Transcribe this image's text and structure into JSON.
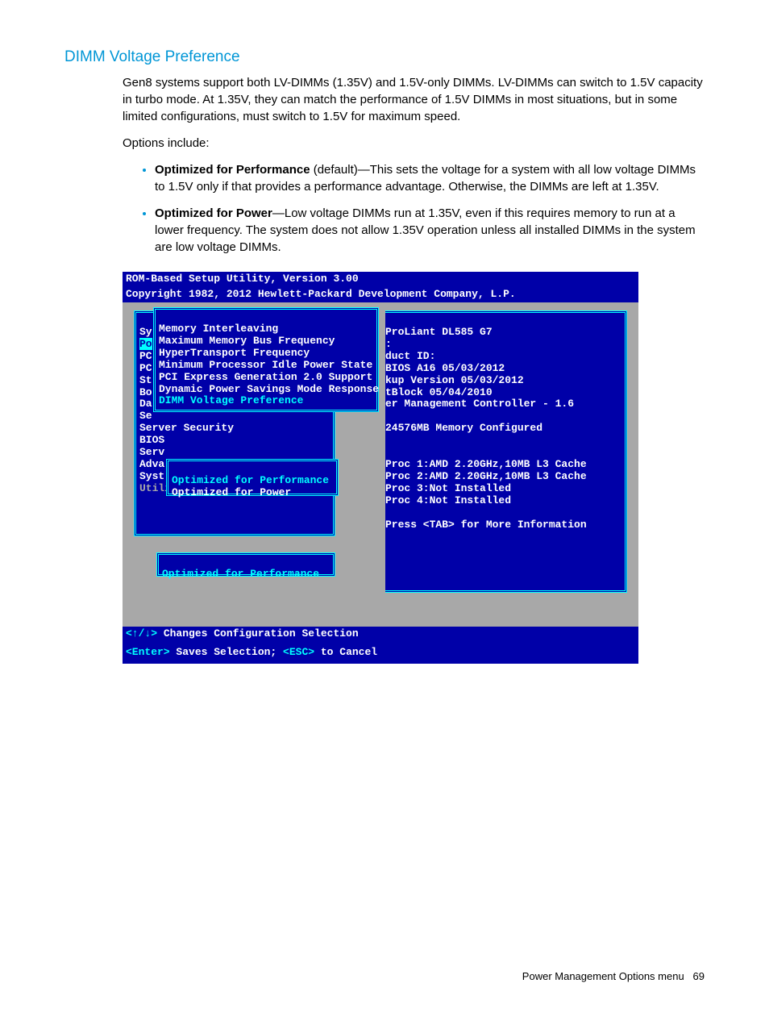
{
  "heading": "DIMM Voltage Preference",
  "para1": "Gen8 systems support both LV-DIMMs (1.35V) and 1.5V-only DIMMs. LV-DIMMs can switch to 1.5V capacity in turbo mode. At 1.35V, they can match the performance of 1.5V DIMMs in most situations, but in some limited configurations, must switch to 1.5V for maximum speed.",
  "options_label": "Options include:",
  "bullets": [
    {
      "strong": "Optimized for Performance",
      "rest": " (default)—This sets the voltage for a system with all low voltage DIMMs to 1.5V only if that provides a performance advantage. Otherwise, the DIMMs are left at 1.35V."
    },
    {
      "strong": "Optimized for Power",
      "rest": "—Low voltage DIMMs run at 1.35V, even if this requires memory to run at a lower frequency. The system does not allow 1.35V operation unless all installed DIMMs in the system are low voltage DIMMs."
    }
  ],
  "bios": {
    "header_line1": "ROM-Based Setup Utility, Version 3.00",
    "header_line2": "Copyright 1982, 2012 Hewlett-Packard Development Company, L.P.",
    "left_bg": {
      "l1": "Sy",
      "l2": "Po",
      "l3": "PC",
      "l4": "PC",
      "l5": "St",
      "l6": "Bo",
      "l7": "Da",
      "l8": "Se",
      "l9": "Server Security",
      "l10": "BIOS",
      "l11": "Serv",
      "l12": "Adva",
      "l13": "Syst",
      "l14": "Utility Language"
    },
    "menu": {
      "m1": "Memory Interleaving",
      "m2": "Maximum Memory Bus Frequency",
      "m3": "HyperTransport Frequency",
      "m4": "Minimum Processor Idle Power State",
      "m5": "PCI Express Generation 2.0 Support",
      "m6": "Dynamic Power Savings Mode Response",
      "m7": "DIMM Voltage Preference"
    },
    "submenu": {
      "s1": "Optimized for Performance",
      "s2": "Optimized for Power"
    },
    "current": "Optimized for Performance",
    "info": {
      "i1": "ProLiant DL585 G7",
      "i2": ":",
      "i3": "duct ID:",
      "i4": "BIOS A16 05/03/2012",
      "i5": "kup Version 05/03/2012",
      "i6": "tBlock 05/04/2010",
      "i7": "er Management Controller - 1.6",
      "i8": "24576MB Memory Configured",
      "i9": "Proc 1:AMD 2.20GHz,10MB L3 Cache",
      "i10": "Proc 2:AMD 2.20GHz,10MB L3 Cache",
      "i11": "Proc 3:Not Installed",
      "i12": "Proc 4:Not Installed",
      "i13": "Press <TAB> for More Information"
    },
    "footer_line1_a": "<↑/↓>",
    "footer_line1_b": " Changes Configuration Selection",
    "footer_line2_a": "<Enter>",
    "footer_line2_b": " Saves Selection; ",
    "footer_line2_c": "<ESC>",
    "footer_line2_d": " to Cancel"
  },
  "footer": {
    "text": "Power Management Options menu",
    "page": "69"
  }
}
